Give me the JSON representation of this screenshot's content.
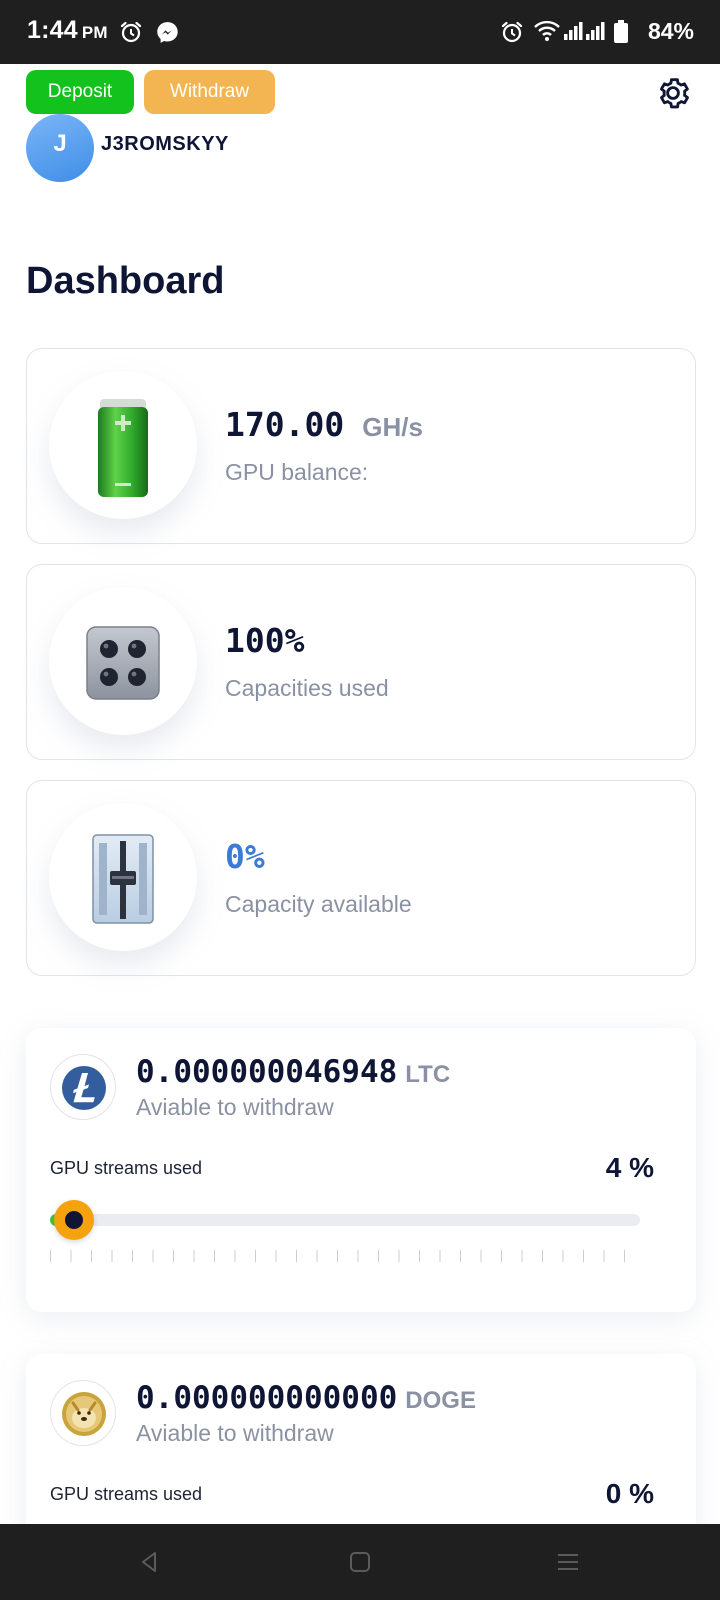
{
  "status_bar": {
    "time": "1:44",
    "ampm": "PM",
    "battery": "84%",
    "icons": [
      "alarm-icon",
      "messenger-icon",
      "alarm-icon",
      "wifi-icon",
      "signal-icon",
      "battery-icon"
    ]
  },
  "header": {
    "deposit_label": "Deposit",
    "withdraw_label": "Withdraw",
    "avatar_initial": "J",
    "username": "J3ROMSKYY",
    "settings_icon": "gear-icon"
  },
  "page": {
    "title": "Dashboard"
  },
  "stats": [
    {
      "value": "170.00",
      "unit": "GH/s",
      "label": "GPU balance:",
      "icon": "battery-icon"
    },
    {
      "value": "100%",
      "label": "Capacities used",
      "icon": "chip-icon"
    },
    {
      "value": "0%",
      "label": "Capacity available",
      "icon": "fader-icon"
    }
  ],
  "coins": [
    {
      "amount": "0.000000046948",
      "ticker": "LTC",
      "sub": "Aviable to withdraw",
      "streams_label": "GPU streams used",
      "streams_value": "4 %",
      "streams_percent": 4,
      "icon": "litecoin-icon"
    },
    {
      "amount": "0.000000000000",
      "ticker": "DOGE",
      "sub": "Aviable to withdraw",
      "streams_label": "GPU streams used",
      "streams_value": "0 %",
      "streams_percent": 0,
      "icon": "dogecoin-icon"
    }
  ],
  "colors": {
    "deposit": "#14c21d",
    "withdraw": "#f3b551",
    "slider_thumb": "#f5a20f",
    "accent_blue": "#3a7bd5",
    "text_dark": "#0f1535"
  },
  "nav": {
    "icons": [
      "back-icon",
      "home-icon",
      "recents-icon"
    ]
  }
}
